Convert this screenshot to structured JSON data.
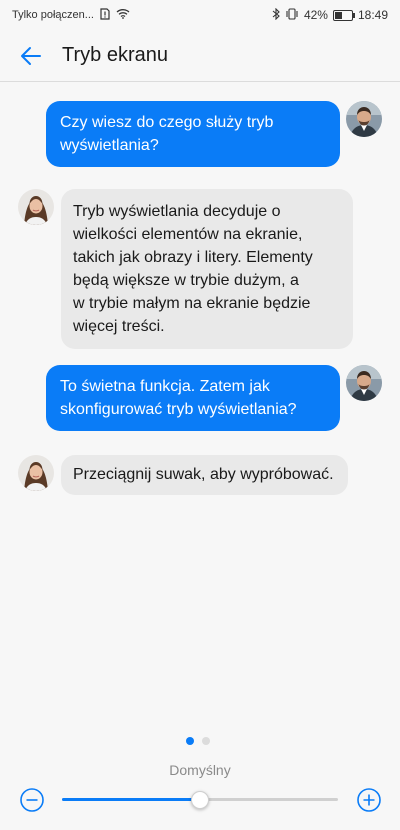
{
  "status_bar": {
    "carrier": "Tylko połączen...",
    "battery": "42%",
    "time": "18:49"
  },
  "header": {
    "title": "Tryb ekranu"
  },
  "messages": [
    {
      "from": "user",
      "lines": [
        "Czy wiesz do czego służy tryb",
        "wyświetlania?"
      ]
    },
    {
      "from": "assistant",
      "lines": [
        "Tryb wyświetlania decyduje o",
        "wielkości elementów na ekranie,",
        "takich jak obrazy i litery. Elementy",
        "będą większe w trybie dużym, a",
        "w trybie małym na ekranie będzie",
        "więcej treści."
      ]
    },
    {
      "from": "user",
      "lines": [
        "To świetna funkcja. Zatem jak",
        "skonfigurować tryb wyświetlania?"
      ]
    },
    {
      "from": "assistant",
      "lines": [
        "Przeciągnij suwak, aby wypróbować."
      ]
    }
  ],
  "pager": {
    "count": 2,
    "active": 0
  },
  "mode": {
    "label": "Domyślny"
  },
  "slider": {
    "value": 0.5
  },
  "colors": {
    "accent": "#0a7cf7",
    "bubble_in": "#e9e9e9",
    "bubble_out": "#0a7cf7"
  }
}
